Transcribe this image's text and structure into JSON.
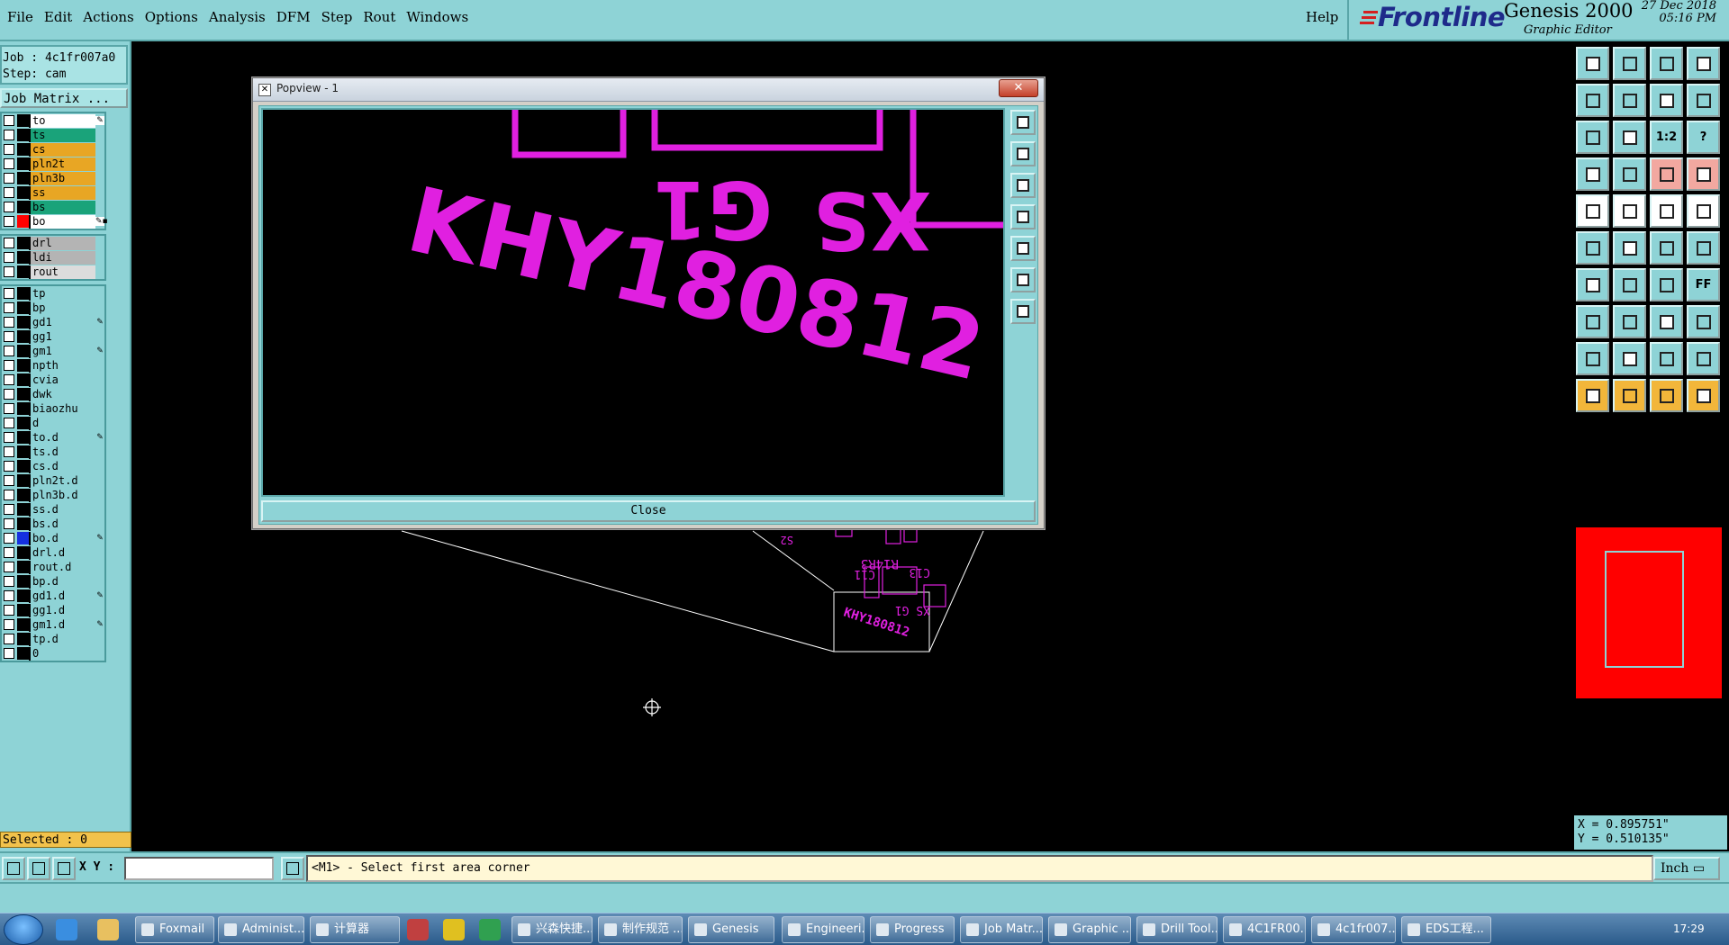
{
  "menubar": {
    "items": [
      "File",
      "Edit",
      "Actions",
      "Options",
      "Analysis",
      "DFM",
      "Step",
      "Rout",
      "Windows"
    ],
    "help": "Help"
  },
  "brand": {
    "logo": "Frontline",
    "product": "Genesis 2000",
    "subtitle": "Graphic Editor",
    "date": "27 Dec 2018",
    "time": "05:16 PM"
  },
  "left_panel": {
    "job": "Job : 4c1fr007a0",
    "step": "Step: cam",
    "job_matrix_button": "Job Matrix ...",
    "layer_groups": [
      [
        {
          "name": "to",
          "color": "#ffffff",
          "swatch": "#000000",
          "mark": "✎"
        },
        {
          "name": "ts",
          "color": "#1aa37a",
          "swatch": "#000000",
          "mark": ""
        },
        {
          "name": "cs",
          "color": "#e8a624",
          "swatch": "#000000",
          "mark": ""
        },
        {
          "name": "pln2t",
          "color": "#e8a624",
          "swatch": "#000000",
          "mark": ""
        },
        {
          "name": "pln3b",
          "color": "#e8a624",
          "swatch": "#000000",
          "mark": ""
        },
        {
          "name": "ss",
          "color": "#e8a624",
          "swatch": "#000000",
          "mark": ""
        },
        {
          "name": "bs",
          "color": "#1aa37a",
          "swatch": "#000000",
          "mark": ""
        },
        {
          "name": "bo",
          "color": "#ffffff",
          "swatch": "#ff0000",
          "mark": "✎▪"
        }
      ],
      [
        {
          "name": "drl",
          "color": "#b4b4b4",
          "swatch": "#000000",
          "mark": ""
        },
        {
          "name": "ldi",
          "color": "#b4b4b4",
          "swatch": "#000000",
          "mark": ""
        },
        {
          "name": "rout",
          "color": "#dcdcdc",
          "swatch": "#000000",
          "mark": ""
        }
      ],
      [
        {
          "name": "tp",
          "color": "#8ed3d6",
          "swatch": "#000000",
          "mark": ""
        },
        {
          "name": "bp",
          "color": "#8ed3d6",
          "swatch": "#000000",
          "mark": ""
        },
        {
          "name": "gd1",
          "color": "#8ed3d6",
          "swatch": "#000000",
          "mark": "✎"
        },
        {
          "name": "gg1",
          "color": "#8ed3d6",
          "swatch": "#000000",
          "mark": ""
        },
        {
          "name": "gm1",
          "color": "#8ed3d6",
          "swatch": "#000000",
          "mark": "✎"
        },
        {
          "name": "npth",
          "color": "#8ed3d6",
          "swatch": "#000000",
          "mark": ""
        },
        {
          "name": "cvia",
          "color": "#8ed3d6",
          "swatch": "#000000",
          "mark": ""
        },
        {
          "name": "dwk",
          "color": "#8ed3d6",
          "swatch": "#000000",
          "mark": ""
        },
        {
          "name": "biaozhu",
          "color": "#8ed3d6",
          "swatch": "#000000",
          "mark": ""
        },
        {
          "name": "d",
          "color": "#8ed3d6",
          "swatch": "#000000",
          "mark": ""
        },
        {
          "name": "to.d",
          "color": "#8ed3d6",
          "swatch": "#000000",
          "mark": "✎"
        },
        {
          "name": "ts.d",
          "color": "#8ed3d6",
          "swatch": "#000000",
          "mark": ""
        },
        {
          "name": "cs.d",
          "color": "#8ed3d6",
          "swatch": "#000000",
          "mark": ""
        },
        {
          "name": "pln2t.d",
          "color": "#8ed3d6",
          "swatch": "#000000",
          "mark": ""
        },
        {
          "name": "pln3b.d",
          "color": "#8ed3d6",
          "swatch": "#000000",
          "mark": ""
        },
        {
          "name": "ss.d",
          "color": "#8ed3d6",
          "swatch": "#000000",
          "mark": ""
        },
        {
          "name": "bs.d",
          "color": "#8ed3d6",
          "swatch": "#000000",
          "mark": ""
        },
        {
          "name": "bo.d",
          "color": "#8ed3d6",
          "swatch": "#1530e0",
          "mark": "✎"
        },
        {
          "name": "drl.d",
          "color": "#8ed3d6",
          "swatch": "#000000",
          "mark": ""
        },
        {
          "name": "rout.d",
          "color": "#8ed3d6",
          "swatch": "#000000",
          "mark": ""
        },
        {
          "name": "bp.d",
          "color": "#8ed3d6",
          "swatch": "#000000",
          "mark": ""
        },
        {
          "name": "gd1.d",
          "color": "#8ed3d6",
          "swatch": "#000000",
          "mark": "✎"
        },
        {
          "name": "gg1.d",
          "color": "#8ed3d6",
          "swatch": "#000000",
          "mark": ""
        },
        {
          "name": "gm1.d",
          "color": "#8ed3d6",
          "swatch": "#000000",
          "mark": "✎"
        },
        {
          "name": "tp.d",
          "color": "#8ed3d6",
          "swatch": "#000000",
          "mark": ""
        },
        {
          "name": "0",
          "color": "#8ed3d6",
          "swatch": "#000000",
          "mark": ""
        }
      ]
    ],
    "selected": "Selected : 0"
  },
  "popview": {
    "title": "Popview - 1",
    "close_x": "✕",
    "close_button": "Close",
    "zoomed_text": "KHY180812",
    "mirrored_text_1": "XS",
    "mirrored_text_2": "G1",
    "tool_icons": [
      "zoom-window-icon",
      "zoom-in-icon",
      "zoom-out-icon",
      "pan-left-icon",
      "pan-right-icon",
      "zoom-fit-icon",
      "zoom-home-icon"
    ]
  },
  "canvas": {
    "board_text": "KHY180812",
    "board_labels": [
      "XS G1",
      "R14R3",
      "C11",
      "C13",
      "S2"
    ],
    "cursor_icon": "crosshair-icon"
  },
  "right_panel": {
    "tools": [
      {
        "icon": "zoom-in-icon",
        "style": "plain"
      },
      {
        "icon": "zoom-out-icon",
        "style": "plain"
      },
      {
        "icon": "home-icon",
        "style": "plain"
      },
      {
        "icon": "window-icon",
        "style": "plain"
      },
      {
        "icon": "pan-left-icon",
        "style": "plain"
      },
      {
        "icon": "pan-right-icon",
        "style": "plain"
      },
      {
        "icon": "redraw-icon",
        "style": "plain"
      },
      {
        "icon": "snap-icon",
        "style": "plain"
      },
      {
        "icon": "fit-icon",
        "style": "plain"
      },
      {
        "icon": "center-icon",
        "style": "plain"
      },
      {
        "icon": "scale-icon",
        "style": "plain",
        "label": "1:2"
      },
      {
        "icon": "help-icon",
        "style": "plain",
        "label": "?"
      },
      {
        "icon": "ruler-icon",
        "style": "plain"
      },
      {
        "icon": "grid-icon",
        "style": "plain"
      },
      {
        "icon": "measure-icon",
        "style": "redish"
      },
      {
        "icon": "measure2-icon",
        "style": "redish"
      },
      {
        "icon": "pad-icon",
        "style": "white"
      },
      {
        "icon": "outline-icon",
        "style": "white"
      },
      {
        "icon": "line-icon",
        "style": "white"
      },
      {
        "icon": "circle-icon",
        "style": "white"
      },
      {
        "icon": "connect-icon",
        "style": "plain"
      },
      {
        "icon": "cross-icon",
        "style": "plain"
      },
      {
        "icon": "node-icon",
        "style": "plain"
      },
      {
        "icon": "node2-icon",
        "style": "plain"
      },
      {
        "icon": "angle-icon",
        "style": "plain"
      },
      {
        "icon": "slash-icon",
        "style": "plain"
      },
      {
        "icon": "arc-icon",
        "style": "plain"
      },
      {
        "icon": "text-icon",
        "style": "plain",
        "label": "FF"
      },
      {
        "icon": "square-icon",
        "style": "plain"
      },
      {
        "icon": "dash-icon",
        "style": "plain"
      },
      {
        "icon": "box-icon",
        "style": "plain"
      },
      {
        "icon": "group-icon",
        "style": "plain"
      },
      {
        "icon": "triangle-icon",
        "style": "plain"
      },
      {
        "icon": "triangle2-icon",
        "style": "plain"
      },
      {
        "icon": "triangle3-icon",
        "style": "plain"
      },
      {
        "icon": "triangle4-icon",
        "style": "plain"
      },
      {
        "icon": "select-icon",
        "style": "yellow"
      },
      {
        "icon": "select2-icon",
        "style": "yellow"
      },
      {
        "icon": "select3-icon",
        "style": "yellow"
      },
      {
        "icon": "select4-icon",
        "style": "yellow"
      }
    ],
    "coord_x": "X = 0.895751\"",
    "coord_y": "Y = 0.510135\""
  },
  "statusbar": {
    "xy_label": "X Y :",
    "xy_value": "",
    "prompt": "<M1> - Select first area corner",
    "unit": "Inch ▭"
  },
  "taskbar": {
    "tasks": [
      "Foxmail",
      "Administ...",
      "计算器",
      "兴森快捷...",
      "制作规范 ...",
      "Genesis",
      "Engineeri...",
      "Progress",
      "Job Matr...",
      "Graphic ...",
      "Drill Tool...",
      "4C1FR00...",
      "4c1fr007...",
      "EDS工程..."
    ],
    "clock": "17:29"
  },
  "colors": {
    "accent": "#8ed3d6",
    "canvas": "#000000",
    "feature": "#e020e0",
    "selected_bar": "#f2c24b"
  }
}
